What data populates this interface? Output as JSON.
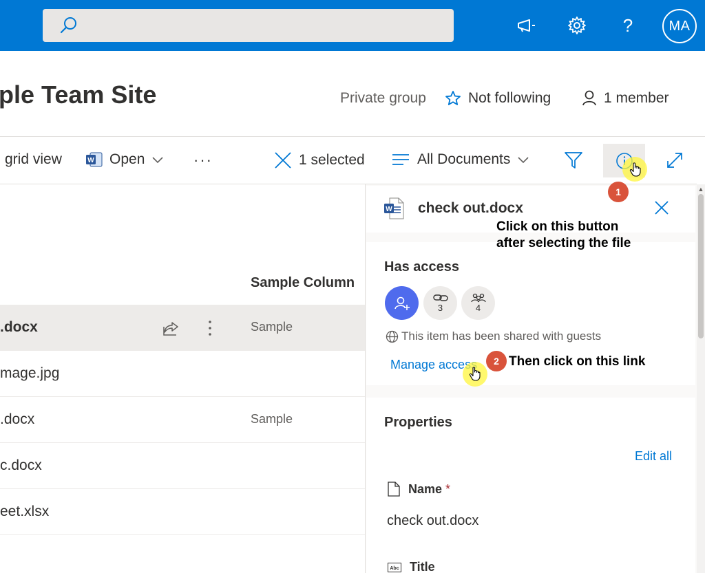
{
  "topbar": {
    "search_icon": "search-icon",
    "icons": [
      "megaphone-icon",
      "gear-icon",
      "help-icon"
    ],
    "help_glyph": "?",
    "avatar_initials": "MA",
    "brand_color": "#0078d4"
  },
  "site": {
    "title": "ple Team Site",
    "group_type": "Private group",
    "follow_label": "Not following",
    "members_label": "1 member"
  },
  "command_bar": {
    "grid_view_label": "grid view",
    "open_label": "Open",
    "more_glyph": "···",
    "selected_label": "1 selected",
    "view_label": "All Documents"
  },
  "file_list": {
    "column_header": "Sample Column",
    "rows": [
      {
        "name": ".docx",
        "sample": "Sample",
        "selected": true
      },
      {
        "name": "mage.jpg",
        "sample": ""
      },
      {
        "name": ".docx",
        "sample": "Sample"
      },
      {
        "name": "c.docx",
        "sample": ""
      },
      {
        "name": "eet.xlsx",
        "sample": ""
      }
    ]
  },
  "details_pane": {
    "file_name": "check out.docx",
    "has_access_title": "Has access",
    "links_count": "3",
    "people_count": "4",
    "shared_note": "This item has been shared with guests",
    "manage_access_label": "Manage access",
    "properties_title": "Properties",
    "edit_all_label": "Edit all",
    "name_label": "Name",
    "required_mark": "*",
    "name_value": "check out.docx",
    "title_label": "Title"
  },
  "annotations": {
    "step1_number": "1",
    "step1_text_line1": "Click on this button",
    "step1_text_line2": "after selecting the file",
    "step2_number": "2",
    "step2_text": "Then click on this link",
    "badge_color": "#d9533b",
    "highlight_color": "#fff63c"
  }
}
